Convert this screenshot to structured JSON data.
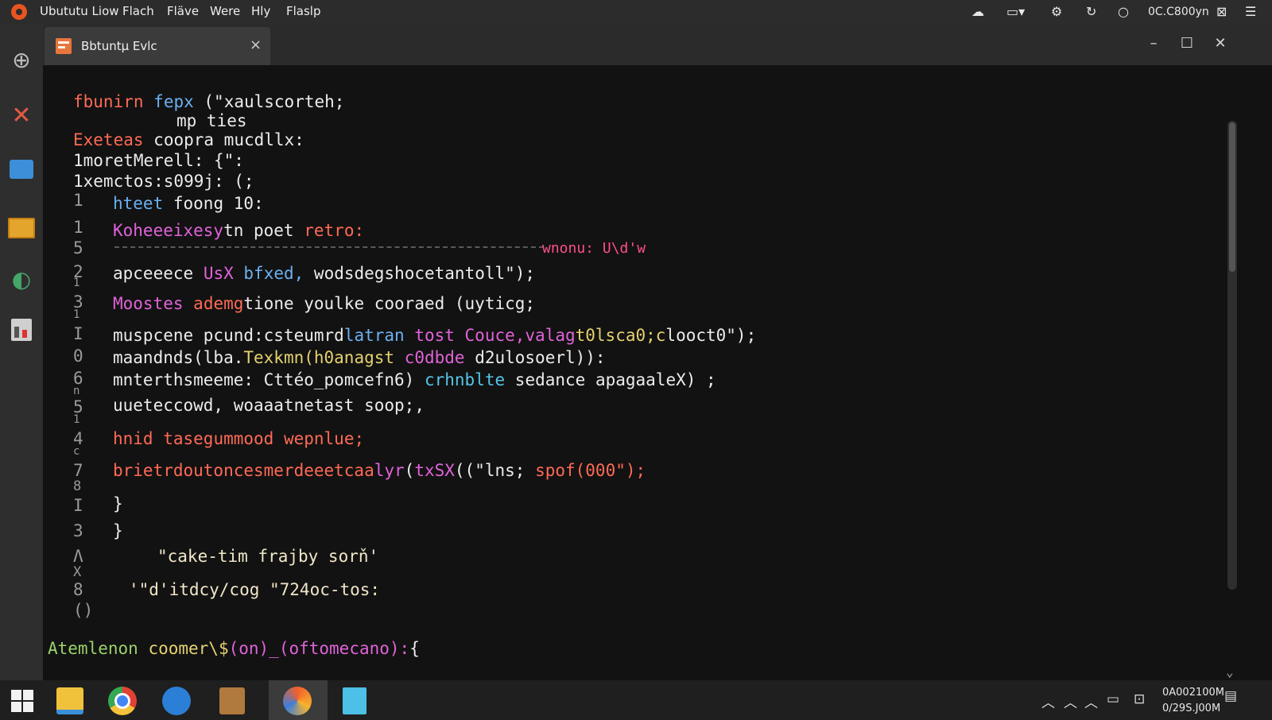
{
  "topbar": {
    "menu": [
      "Ubututu Liow",
      "Flach",
      "Fläve",
      "Were",
      "Hly",
      "Flaslp"
    ],
    "tray_time": "0C.C800yn"
  },
  "window": {
    "tab_title": "Bbtuntµ Evlc",
    "tab_close": "×",
    "minimize": "–",
    "maximize": "☐",
    "close": "✕"
  },
  "gutter": [
    "1",
    "1",
    "5",
    "2",
    "1",
    "3",
    "1",
    "I",
    "0",
    "6",
    "n",
    "5",
    "1",
    "4",
    "c",
    "7",
    "8",
    "I",
    "3",
    "Λ",
    "X",
    "8",
    "()"
  ],
  "code": {
    "line1": {
      "a": "fbunirn",
      "b": "fepx",
      "c": "(\"xaulscorteh;"
    },
    "line2": {
      "a": "mp ties"
    },
    "line3": {
      "a": "Exeteas",
      "b": "coopra mucdllx:"
    },
    "line4": {
      "a": "1moretMerell: {\":"
    },
    "line5": {
      "a": "1xemctos:s099j: (;"
    },
    "line6": {
      "a": "hteet",
      "b": "foong 10:"
    },
    "line7": {
      "a": "Koheeeixesy",
      "b": "tn poet",
      "c": "retro:"
    },
    "line8": {
      "a": "wnonu: U\\d'w"
    },
    "line9": {
      "a": "apceeece",
      "b": "UsX",
      "c": "bfxed,",
      "d": "wodsdegshocetantoll\");"
    },
    "line10": {
      "a": "Moostes",
      "b": "ademg",
      "c": "tione youlke cooraed (uyticg;"
    },
    "line11": {
      "a": "muspcene pcund:",
      "b": "cste",
      "c": "umrd",
      "d": "latran",
      "e": "tost Couce,valag",
      "f": "t0lsca0;c",
      "g": "looct0\");"
    },
    "line12": {
      "a": "maandnds(lba.",
      "b": "Texkmn(h0anagst",
      "c": "c0dbde",
      "d": "d2ulosoerl)):"
    },
    "line13": {
      "a": "mnterthsmeeme:",
      "b": "Cttéo_pomcefn6)",
      "c": "crhnblte",
      "d": "sedance apagaaleX) ;"
    },
    "line14": {
      "a": "uueteccowd,",
      "b": "woaaatnetast",
      "c": "soop;,"
    },
    "line15": {
      "a": "hnid",
      "b": "tasegummood",
      "c": "wepnlue;"
    },
    "line16": {
      "a": "brietrdoutoncesmerdeeetcaa",
      "b": "lyr",
      "c": "(",
      "d": "txSX",
      "e": "((\"lns;",
      "f": "spof(000\");"
    },
    "line17": {
      "a": "}"
    },
    "line18": {
      "a": "}"
    },
    "line19": {
      "a": "\"cake-tim frajby sorň'"
    },
    "line20": {
      "a": "'\"d'itdcy/cog \"724oc-tos:"
    },
    "line21": {
      "a": "Atemlenon",
      "b": "coomer\\$",
      "c": "(on)_(oftomecano):",
      "d": "{"
    }
  },
  "taskbar": {
    "clock_time": "0A002100M",
    "clock_date": "0/29S.J00M"
  },
  "colors": {
    "keyword_red": "#ff6a55",
    "type_blue": "#6cb0f0",
    "magenta": "#e063d9",
    "pink": "#ff4f8a",
    "green": "#9ad26a",
    "yellow": "#e5d170",
    "cyan": "#56c5e8",
    "foreground": "#ececec"
  }
}
